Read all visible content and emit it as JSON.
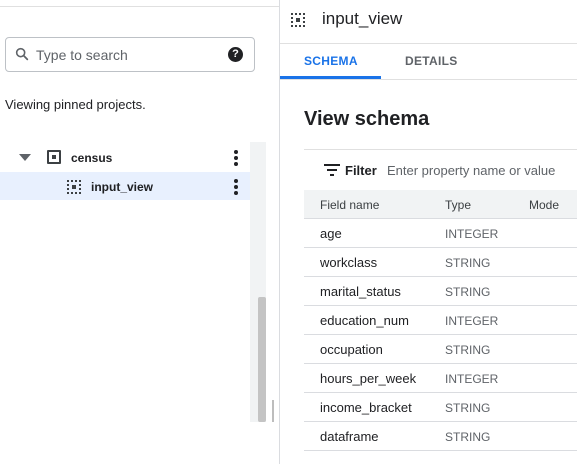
{
  "explorer": {
    "search_placeholder": "Type to search",
    "help_label": "?",
    "pinned_text": "Viewing pinned projects.",
    "tree": [
      {
        "label": "census",
        "type": "dataset",
        "expanded": true
      },
      {
        "label": "input_view",
        "type": "view",
        "selected": true
      }
    ]
  },
  "resource": {
    "title": "input_view",
    "icon": "view-icon"
  },
  "tabs": [
    {
      "label": "SCHEMA",
      "active": true
    },
    {
      "label": "DETAILS",
      "active": false
    }
  ],
  "schema": {
    "section_title": "View schema",
    "filter_label": "Filter",
    "filter_placeholder": "Enter property name or value",
    "columns": [
      "Field name",
      "Type",
      "Mode"
    ],
    "rows": [
      {
        "name": "age",
        "type": "INTEGER",
        "mode": ""
      },
      {
        "name": "workclass",
        "type": "STRING",
        "mode": ""
      },
      {
        "name": "marital_status",
        "type": "STRING",
        "mode": ""
      },
      {
        "name": "education_num",
        "type": "INTEGER",
        "mode": ""
      },
      {
        "name": "occupation",
        "type": "STRING",
        "mode": ""
      },
      {
        "name": "hours_per_week",
        "type": "INTEGER",
        "mode": ""
      },
      {
        "name": "income_bracket",
        "type": "STRING",
        "mode": ""
      },
      {
        "name": "dataframe",
        "type": "STRING",
        "mode": ""
      }
    ]
  },
  "colors": {
    "accent": "#1a73e8",
    "selected_row": "#e8f0fe"
  }
}
